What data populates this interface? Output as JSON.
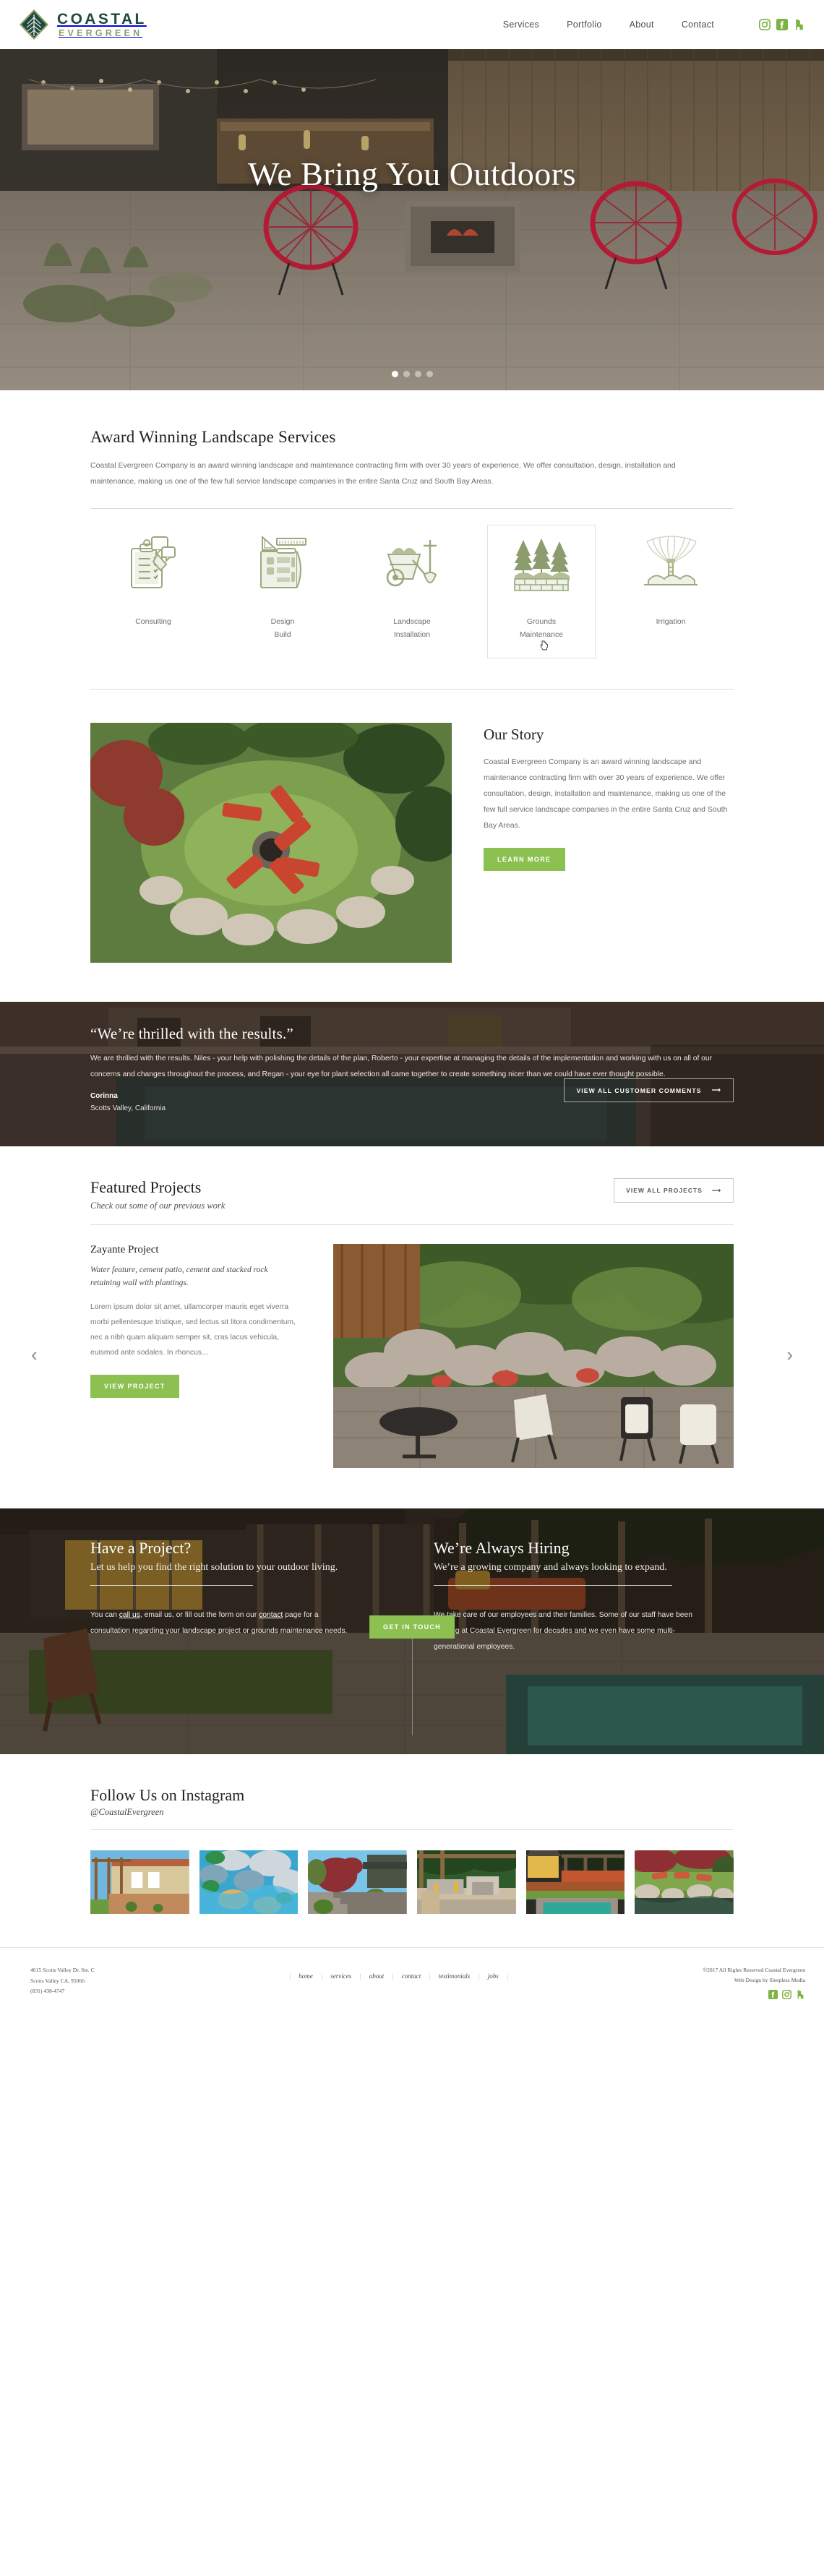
{
  "brand": {
    "name_top": "COASTAL",
    "name_bottom": "EVERGREEN",
    "accent": "#8cc152",
    "dark_green": "#1f4a3d",
    "sage": "#8a9d6b"
  },
  "nav": {
    "items": [
      {
        "label": "Services"
      },
      {
        "label": "Portfolio"
      },
      {
        "label": "About"
      },
      {
        "label": "Contact"
      }
    ],
    "social": [
      {
        "name": "instagram-icon"
      },
      {
        "name": "facebook-icon"
      },
      {
        "name": "houzz-icon"
      }
    ]
  },
  "hero": {
    "title": "We Bring You Outdoors",
    "slides": 4,
    "active_slide": 1
  },
  "services": {
    "heading": "Award Winning Landscape Services",
    "body": "Coastal Evergreen Company is an award winning landscape and maintenance contracting firm with over 30 years of experience. We offer consultation, design, installation and maintenance, making us one of the few full service landscape companies in the entire Santa Cruz and South Bay Areas.",
    "items": [
      {
        "label": "Consulting",
        "icon": "clipboard-icon",
        "active": false
      },
      {
        "label": "Design\nBuild",
        "icon": "blueprint-icon",
        "active": false
      },
      {
        "label": "Landscape\nInstallation",
        "icon": "wheelbarrow-icon",
        "active": false
      },
      {
        "label": "Grounds\nMaintenance",
        "icon": "trees-wall-icon",
        "active": true
      },
      {
        "label": "Irrigation",
        "icon": "sprinkler-icon",
        "active": false
      }
    ]
  },
  "story": {
    "heading": "Our Story",
    "body": "Coastal Evergreen Company is an award winning landscape and maintenance contracting firm with over 30 years of experience. We offer consultation, design, installation and maintenance, making us one of the few full service landscape companies in the entire Santa Cruz and South Bay Areas.",
    "button": "LEARN MORE",
    "image_alt": "aerial-garden-firepit-photo"
  },
  "testimonial": {
    "quote": "“We’re thrilled with the results.”",
    "body": "We are thrilled with the results. Niles - your help with polishing the details of the plan, Roberto - your expertise at managing the details of the implementation and working with us on all of our concerns and changes throughout the process, and Regan - your eye for plant selection all came together to create something nicer than we could have ever thought possible.",
    "author": "Corinna",
    "location": "Scotts Valley, California",
    "button": "VIEW ALL CUSTOMER COMMENTS"
  },
  "projects": {
    "heading": "Featured Projects",
    "subheading": "Check out some of our previous work",
    "view_all": "VIEW ALL PROJECTS",
    "title": "Zayante Project",
    "tagline": "Water feature, cement patio, cement and stacked rock retaining wall with plantings.",
    "body": "Lorem ipsum dolor sit amet, ullamcorper mauris eget viverra morbi pellentesque tristique, sed lectus sit litora condimentum, nec a nibh quam aliquam semper sit, cras lacus vehicula, euismod ante sodales. In rhoncus…",
    "button": "VIEW PROJECT",
    "prev": "‹",
    "next": "›",
    "image_alt": "patio-water-feature-photo"
  },
  "cta": {
    "left": {
      "heading": "Have a Project?",
      "lead": "Let us help you find the right solution to your outdoor living.",
      "body_1": "You can ",
      "link_1": "call us",
      "body_2": ", email us, or fill out the form on our ",
      "link_2": "contact",
      "body_3": " page for a consultation regarding your landscape project or grounds maintenance needs."
    },
    "button": "GET IN TOUCH",
    "right": {
      "heading": "We’re Always Hiring",
      "lead": "We’re a growing company and always looking to expand.",
      "body": "We take care of our employees and their families. Some of our staff have been working at Coastal Evergreen for decades and we even have some multi-generational employees."
    }
  },
  "instagram": {
    "heading": "Follow Us on Instagram",
    "handle": "@CoastalEvergreen",
    "photos": [
      {
        "alt": "pergola-patio-photo"
      },
      {
        "alt": "rock-water-feature-photo"
      },
      {
        "alt": "japanese-maple-steps-photo"
      },
      {
        "alt": "outdoor-kitchen-photo"
      },
      {
        "alt": "pool-pergola-photo"
      },
      {
        "alt": "pond-lounge-chairs-photo"
      }
    ]
  },
  "footer": {
    "address_line1": "4615 Scotts Valley Dr. Ste. C",
    "address_line2": "Scotts Valley CA, 95066",
    "phone": "(831) 438-4747",
    "nav": [
      {
        "label": "home"
      },
      {
        "label": "services"
      },
      {
        "label": "about"
      },
      {
        "label": "contact"
      },
      {
        "label": "testimonials"
      },
      {
        "label": "jobs"
      }
    ],
    "copyright": "©2017 All Rights Reserved Coastal Evergreen",
    "credit": "Web Design by Sleepless Media",
    "social": [
      {
        "name": "facebook-icon"
      },
      {
        "name": "instagram-icon"
      },
      {
        "name": "houzz-icon"
      }
    ]
  }
}
